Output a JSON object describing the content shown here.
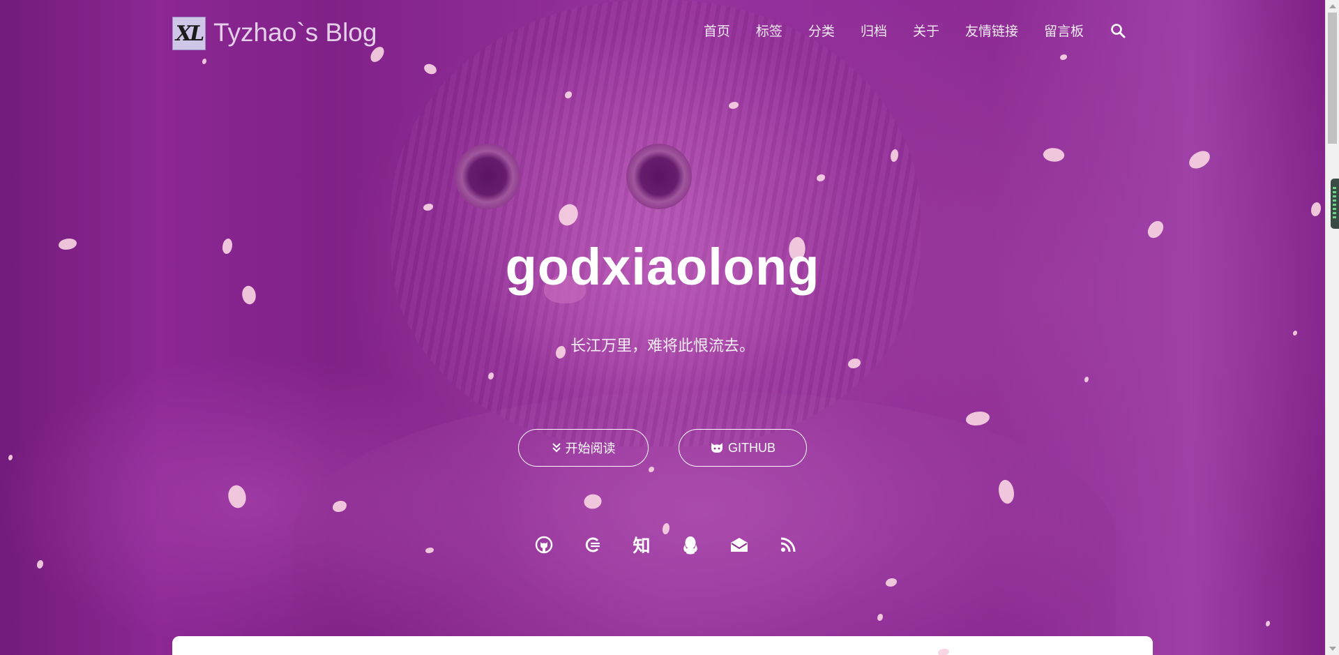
{
  "header": {
    "logo_text": "XL",
    "brand": "Tyzhao`s Blog",
    "nav": [
      "首页",
      "标签",
      "分类",
      "归档",
      "关于",
      "友情链接",
      "留言板"
    ]
  },
  "hero": {
    "title": "godxiaolong",
    "subtitle": "长江万里，难将此恨流去。",
    "buttons": {
      "start_reading": "开始阅读",
      "github": "GITHUB"
    },
    "social_zhihu_glyph": "知"
  },
  "icons": {
    "search": "search-icon",
    "start_reading": "double-chevron-down-icon",
    "github_button": "github-cat-icon",
    "social": [
      "github-icon",
      "csdn-icon",
      "zhihu-icon",
      "qq-icon",
      "email-icon",
      "rss-icon"
    ]
  },
  "colors": {
    "hero_tint": "#8a2a8f",
    "petal": "#f7d3e2",
    "text": "#ffffff"
  }
}
